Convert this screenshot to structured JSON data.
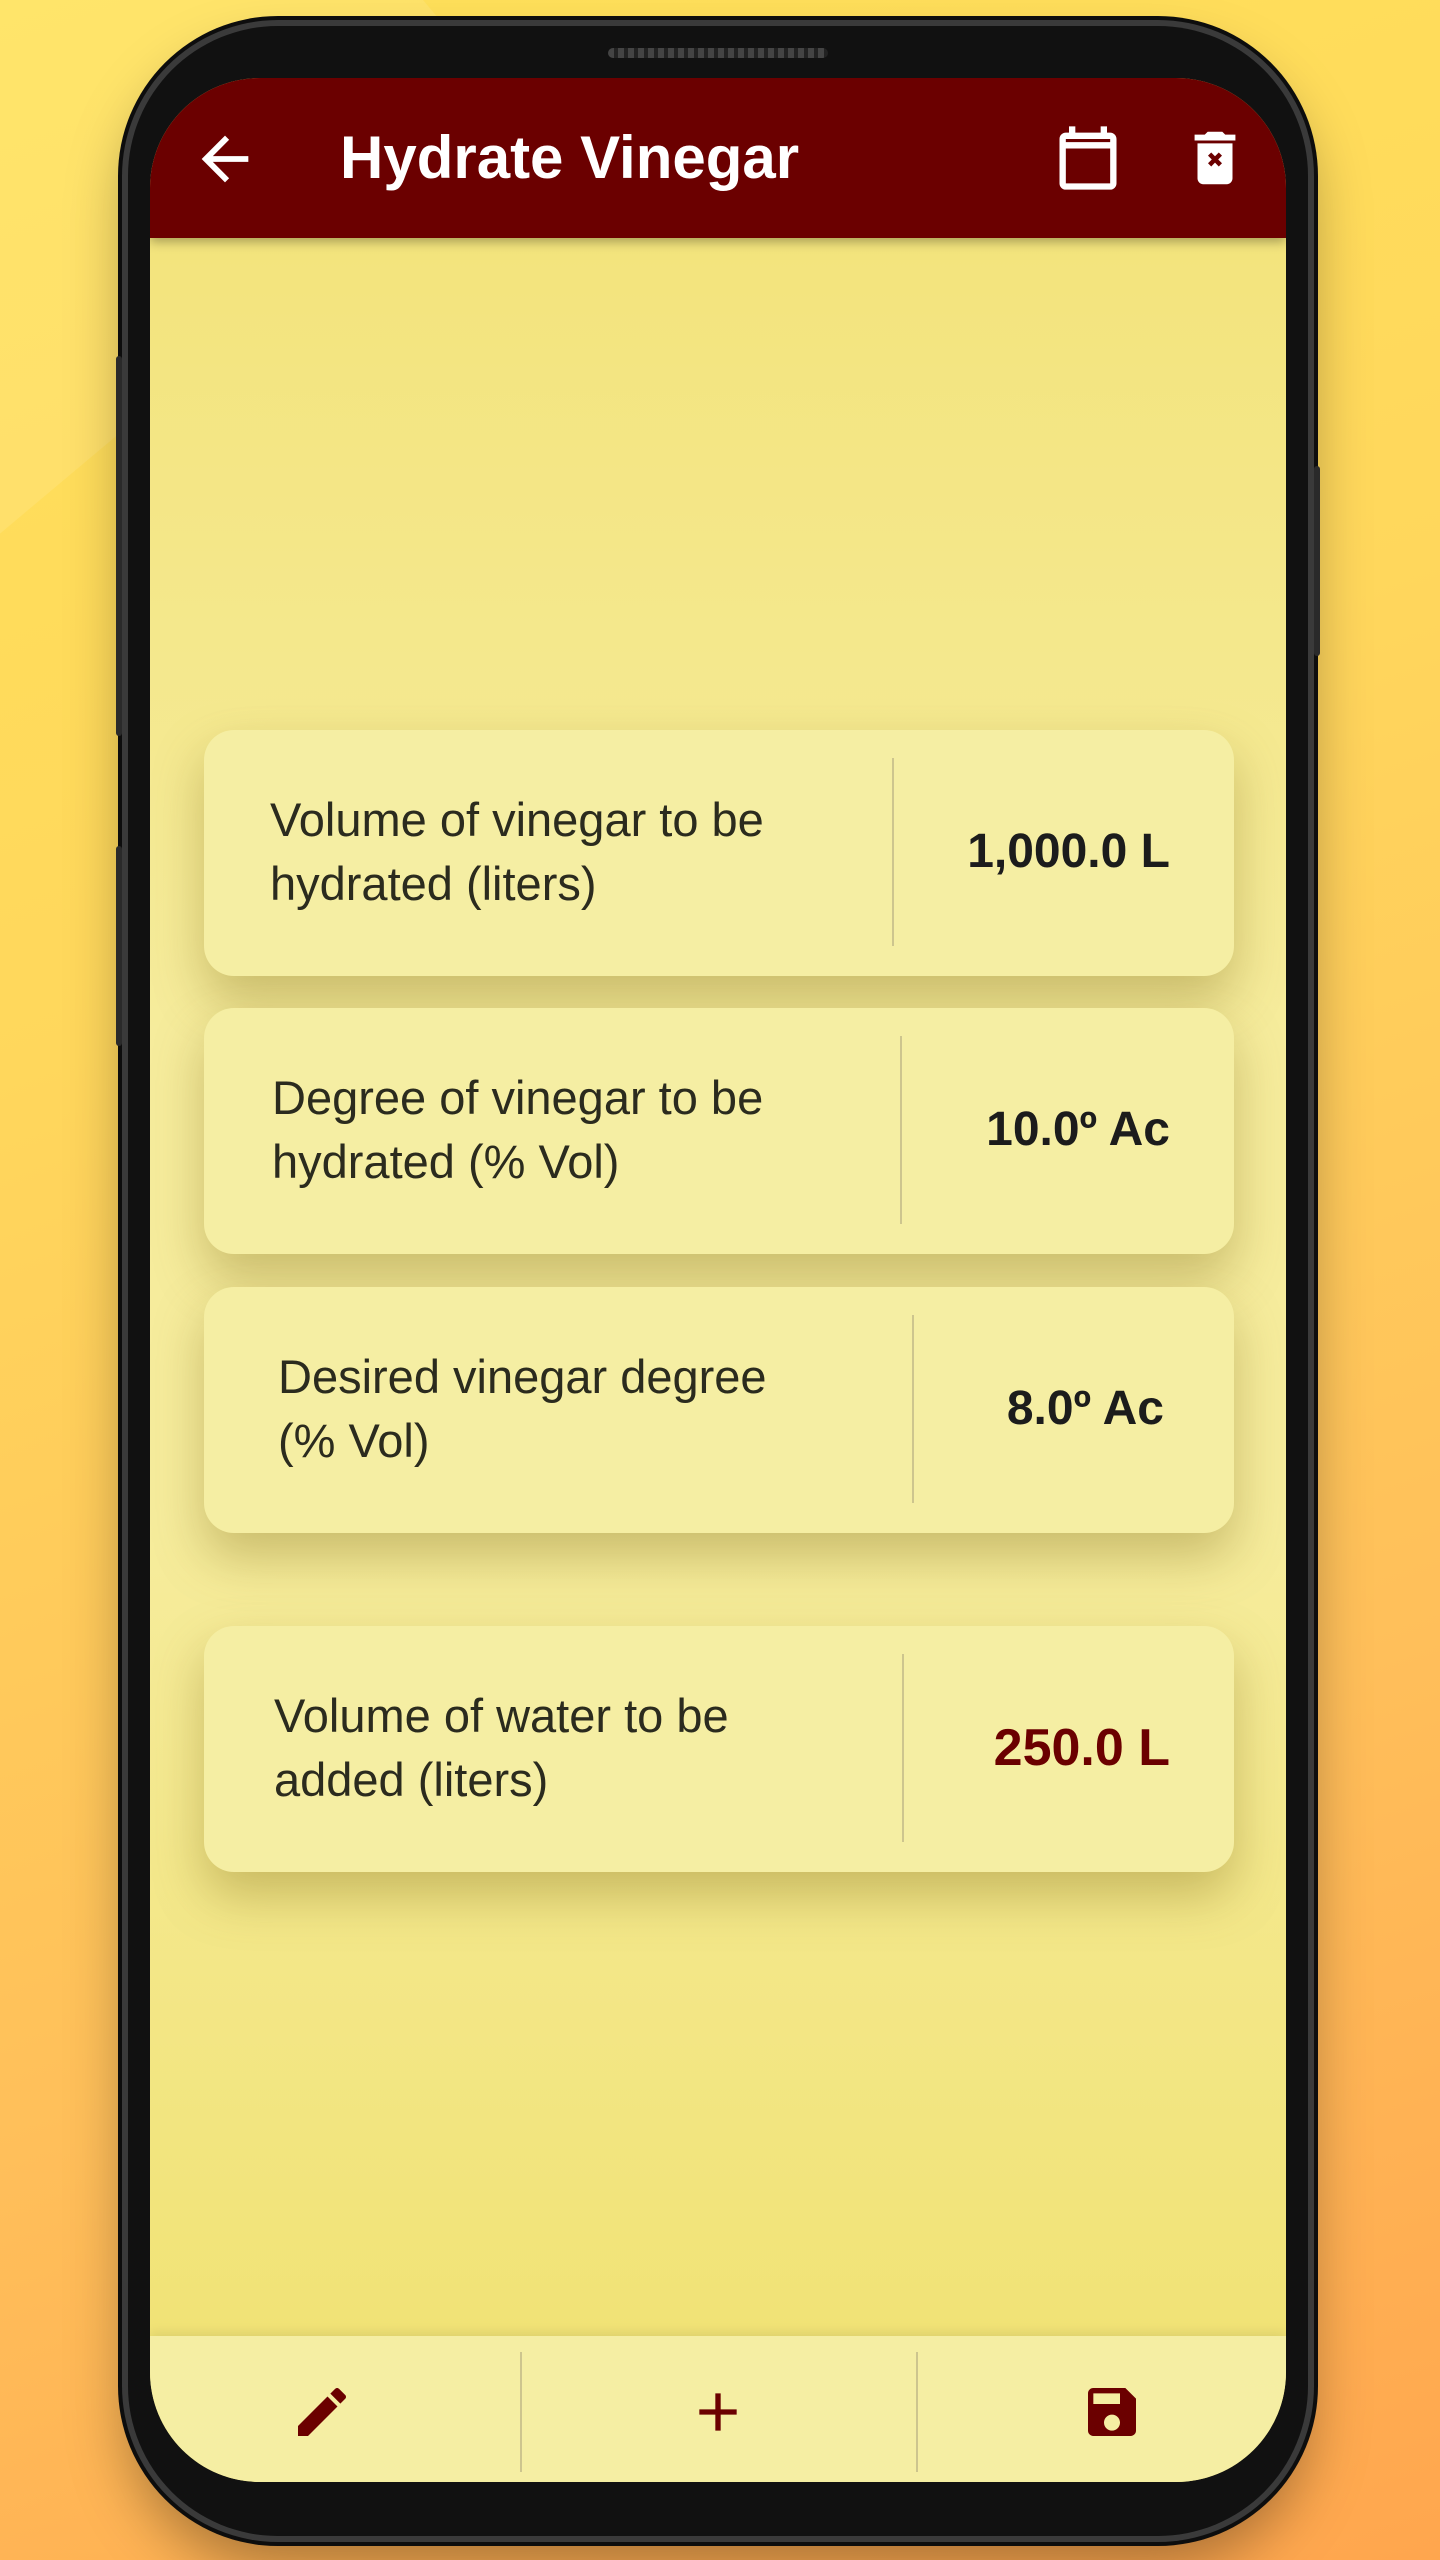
{
  "app_bar": {
    "title": "Hydrate Vinegar",
    "back_icon": "arrow-left-icon",
    "calendar_icon": "calendar-icon",
    "delete_icon": "trash-x-icon",
    "background_color": "#6b0000"
  },
  "fields": [
    {
      "label": "Volume of vinegar to be hydrated (liters)",
      "value": "1,000.0 L"
    },
    {
      "label": "Degree of vinegar to be hydrated (% Vol)",
      "value": "10.0º Ac"
    },
    {
      "label": "Desired vinegar degree (% Vol)",
      "value": "8.0º Ac"
    }
  ],
  "result": {
    "label": "Volume of water to be added (liters)",
    "value": "250.0 L",
    "value_color": "#6b0000"
  },
  "bottom_bar": {
    "edit_icon": "pencil-icon",
    "add_icon": "plus-icon",
    "save_icon": "floppy-disk-icon",
    "icon_color": "#6b0000"
  }
}
